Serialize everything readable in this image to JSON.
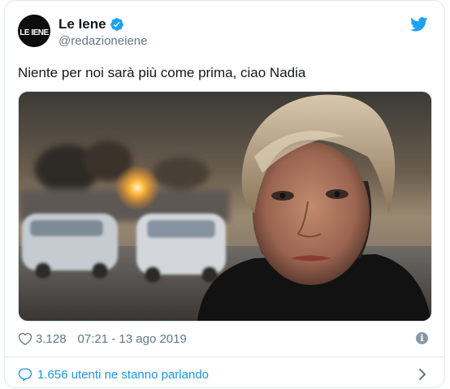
{
  "author": {
    "display_name": "Le Iene",
    "handle": "@redazioneiene",
    "avatar_icon": "le-iene-logo",
    "avatar_text": "LE IENE",
    "verified": true
  },
  "tweet": {
    "text": "Niente per noi sarà più come prima, ciao Nadia",
    "likes": "3.128",
    "timestamp": "07:21 - 13 ago 2019"
  },
  "footer": {
    "talking_label": "1.656 utenti ne stanno parlando"
  },
  "colors": {
    "twitter_blue": "#1da1f2",
    "link_blue": "#1b95e0",
    "muted_gray": "#657786",
    "border": "#e1e8ed"
  },
  "icons": {
    "bird": "twitter-bird-icon",
    "verified": "verified-badge-icon",
    "like": "heart-icon",
    "info": "info-icon",
    "conversation": "speech-bubble-icon",
    "chevron": "chevron-right-icon"
  }
}
